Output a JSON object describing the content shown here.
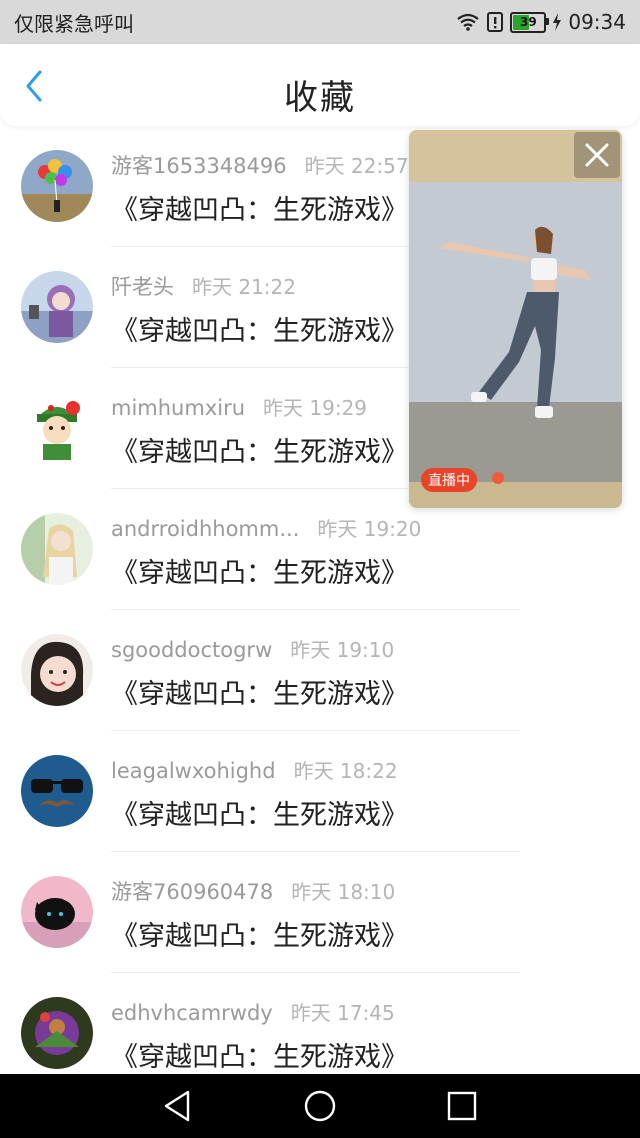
{
  "status": {
    "carrier": "仅限紧急呼叫",
    "battery": "39",
    "time": "09:34"
  },
  "header": {
    "title": "收藏"
  },
  "favorites": [
    {
      "user": "游客1653348496",
      "time": "昨天 22:57",
      "message": "《穿越凹凸：生死游戏》"
    },
    {
      "user": "阡老头",
      "time": "昨天 21:22",
      "message": "《穿越凹凸：生死游戏》"
    },
    {
      "user": "mimhumxiru",
      "time": "昨天 19:29",
      "message": "《穿越凹凸：生死游戏》"
    },
    {
      "user": "andrroidhhomm...",
      "time": "昨天 19:20",
      "message": "《穿越凹凸：生死游戏》"
    },
    {
      "user": "sgooddoctogrw",
      "time": "昨天 19:10",
      "message": "《穿越凹凸：生死游戏》"
    },
    {
      "user": "leagalwxohighd",
      "time": "昨天 18:22",
      "message": "《穿越凹凸：生死游戏》"
    },
    {
      "user": "游客760960478",
      "time": "昨天 18:10",
      "message": "《穿越凹凸：生死游戏》"
    },
    {
      "user": "edhvhcamrwdy",
      "time": "昨天 17:45",
      "message": "《穿越凹凸：生死游戏》"
    }
  ],
  "live_window": {
    "badge": "直播中"
  },
  "colors": {
    "accent": "#2f9cf0",
    "live_badge": "#e8442a"
  },
  "icons": [
    "wifi-icon",
    "alert-icon",
    "battery-icon",
    "charging-icon",
    "back-arrow-icon",
    "close-icon",
    "nav-back-icon",
    "nav-home-icon",
    "nav-recents-icon"
  ]
}
